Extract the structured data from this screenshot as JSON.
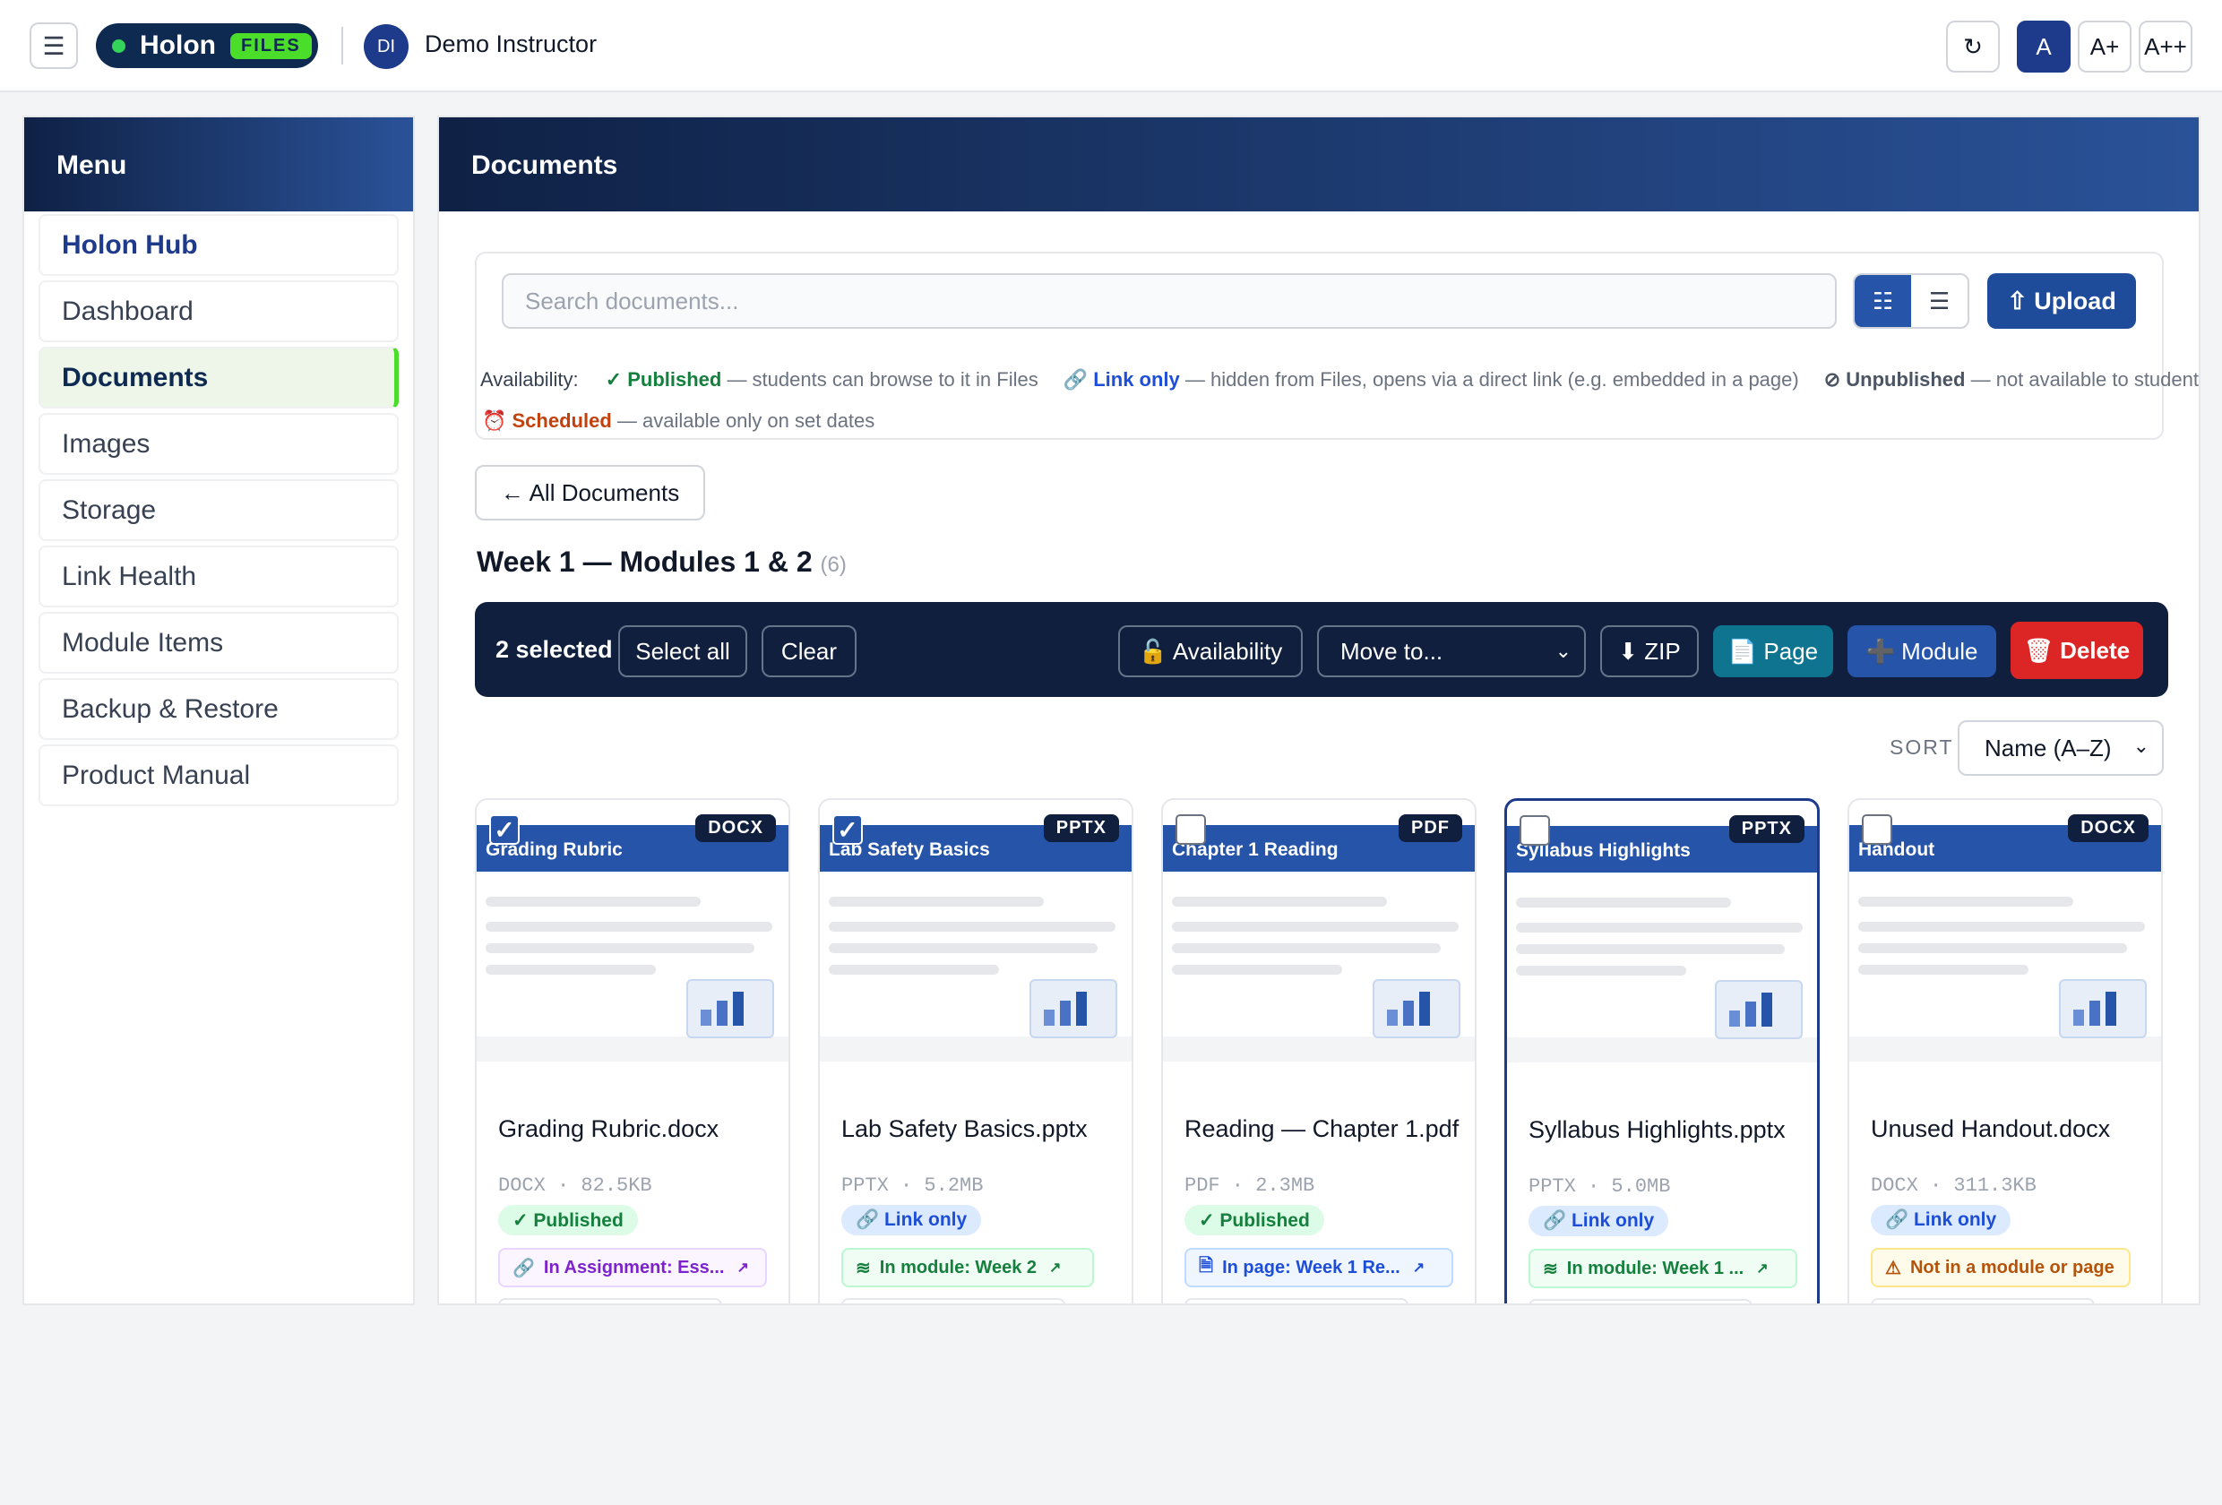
{
  "header": {
    "brand_name": "Holon",
    "brand_badge": "FILES",
    "user_initials": "DI",
    "user_name": "Demo Instructor",
    "refresh_icon": "↻",
    "font_sizes": [
      "A",
      "A+",
      "A++"
    ],
    "active_font_size": "A"
  },
  "sidebar": {
    "title": "Menu",
    "items": [
      {
        "label": "Holon Hub"
      },
      {
        "label": "Dashboard"
      },
      {
        "label": "Documents"
      },
      {
        "label": "Images"
      },
      {
        "label": "Storage"
      },
      {
        "label": "Link Health"
      },
      {
        "label": "Module Items"
      },
      {
        "label": "Backup & Restore"
      },
      {
        "label": "Product Manual"
      }
    ],
    "selected": "Documents"
  },
  "main": {
    "title": "Documents",
    "search_placeholder": "Search documents...",
    "view_toggle": [
      "grid-icon",
      "list-icon"
    ],
    "upload_label": "⇧ Upload",
    "availability": {
      "label": "Availability:",
      "published_name": "✓ Published",
      "published_desc": " — students can browse to it in Files",
      "link_name": "🔗 Link only",
      "link_desc": " — hidden from Files, opens via a direct link (e.g. embedded in a page)",
      "unpublished_name": "⊘ Unpublished",
      "unpublished_desc": " — not available to students",
      "scheduled_name": "⏰ Scheduled",
      "scheduled_desc": " — available only on set dates"
    },
    "back_label": "← All Documents",
    "folder_title": "Week 1 — Modules 1 & 2",
    "folder_count": "(6)",
    "bulk": {
      "selected_text": "2 selected",
      "select_all": "Select all",
      "clear": "Clear",
      "availability": "🔓 Availability",
      "move_to": "Move to...",
      "zip": "⬇ ZIP",
      "page": "📄 Page",
      "module": "➕ Module",
      "delete": "🗑 Delete"
    },
    "sort_label": "SORT",
    "sort_value": "Name (A–Z)",
    "cards": [
      {
        "header_title": "Grading Rubric",
        "type": "DOCX",
        "checked": true,
        "file_name": "Grading Rubric.docx",
        "meta": "DOCX · 82.5KB",
        "status": "✓ Published",
        "usage": "In Assignment: Ess..."
      },
      {
        "header_title": "Lab Safety Basics",
        "type": "PPTX",
        "checked": true,
        "file_name": "Lab Safety Basics.pptx",
        "meta": "PPTX · 5.2MB",
        "status": "🔗 Link only",
        "usage": "In module: Week 2"
      },
      {
        "header_title": "Chapter 1 Reading",
        "type": "PDF",
        "checked": false,
        "file_name": "Reading — Chapter 1.pdf",
        "meta": "PDF · 2.3MB",
        "status": "✓ Published",
        "usage": "In page: Week 1 Re..."
      },
      {
        "header_title": "Syllabus Highlights",
        "type": "PPTX",
        "checked": false,
        "file_name": "Syllabus Highlights.pptx",
        "meta": "PPTX · 5.0MB",
        "status": "🔗 Link only",
        "usage": "In module: Week 1 ..."
      },
      {
        "header_title": "Handout",
        "type": "DOCX",
        "checked": false,
        "file_name": "Unused Handout.docx",
        "meta": "DOCX · 311.3KB",
        "status": "🔗 Link only",
        "usage": "Not in a module or page"
      }
    ]
  }
}
